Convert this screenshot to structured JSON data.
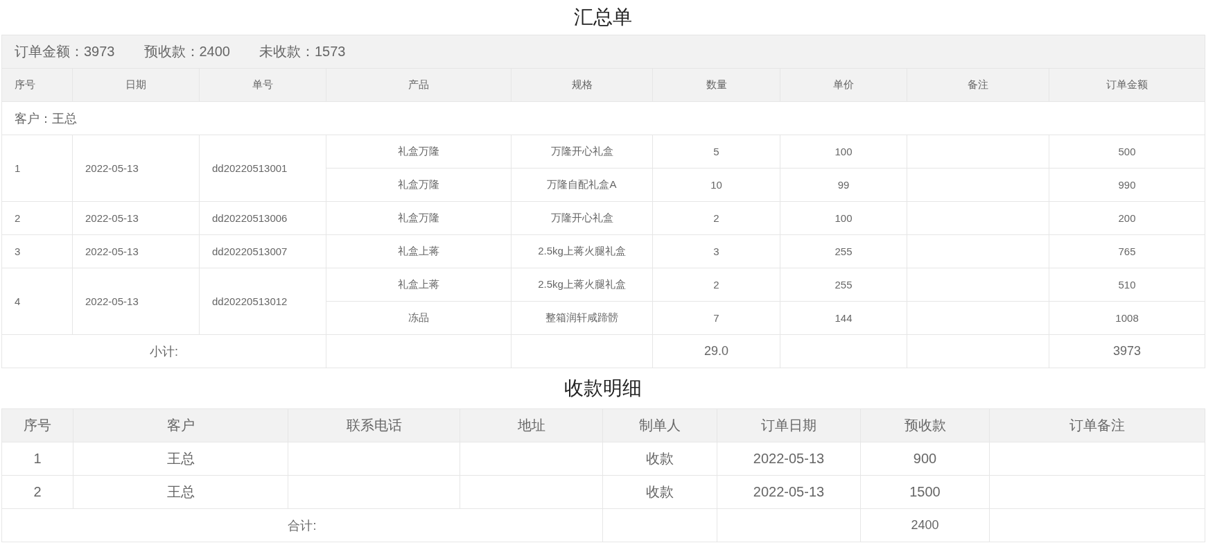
{
  "summary": {
    "title": "汇总单",
    "totals": [
      "订单金额：3973",
      "预收款：2400",
      "未收款：1573"
    ],
    "columns": [
      "序号",
      "日期",
      "单号",
      "产品",
      "规格",
      "数量",
      "单价",
      "备注",
      "订单金额"
    ],
    "customer": "客户：王总",
    "orders": [
      {
        "no": "1",
        "date": "2022-05-13",
        "order_no": "dd20220513001",
        "items": [
          {
            "product": "礼盒万隆",
            "spec": "万隆开心礼盒",
            "qty": "5",
            "price": "100",
            "amount": "500"
          },
          {
            "product": "礼盒万隆",
            "spec": "万隆自配礼盒A",
            "qty": "10",
            "price": "99",
            "amount": "990"
          }
        ]
      },
      {
        "no": "2",
        "date": "2022-05-13",
        "order_no": "dd20220513006",
        "items": [
          {
            "product": "礼盒万隆",
            "spec": "万隆开心礼盒",
            "qty": "2",
            "price": "100",
            "amount": "200"
          }
        ]
      },
      {
        "no": "3",
        "date": "2022-05-13",
        "order_no": "dd20220513007",
        "items": [
          {
            "product": "礼盒上蒋",
            "spec": "2.5kg上蒋火腿礼盒",
            "qty": "3",
            "price": "255",
            "amount": "765"
          }
        ]
      },
      {
        "no": "4",
        "date": "2022-05-13",
        "order_no": "dd20220513012",
        "items": [
          {
            "product": "礼盒上蒋",
            "spec": "2.5kg上蒋火腿礼盒",
            "qty": "2",
            "price": "255",
            "amount": "510"
          },
          {
            "product": "冻品",
            "spec": "整箱润轩咸蹄髈",
            "qty": "7",
            "price": "144",
            "amount": "1008"
          }
        ]
      }
    ],
    "subtotal": {
      "label": "小计:",
      "qty": "29.0",
      "amount": "3973"
    }
  },
  "payments": {
    "title": "收款明细",
    "columns": [
      "序号",
      "客户",
      "联系电话",
      "地址",
      "制单人",
      "订单日期",
      "预收款",
      "订单备注"
    ],
    "rows": [
      {
        "no": "1",
        "customer": "王总",
        "maker": "收款",
        "date": "2022-05-13",
        "prepaid": "900"
      },
      {
        "no": "2",
        "customer": "王总",
        "maker": "收款",
        "date": "2022-05-13",
        "prepaid": "1500"
      }
    ],
    "total": {
      "label": "合计:",
      "prepaid": "2400"
    }
  }
}
